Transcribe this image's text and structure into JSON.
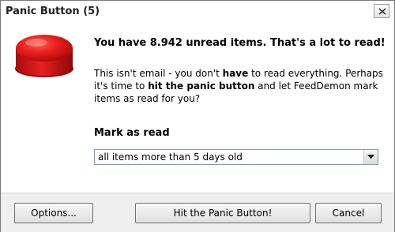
{
  "window": {
    "title": "Panic Button (5)"
  },
  "icons": {
    "panic": "red-panic-button-icon",
    "close": "close-icon",
    "dropdown": "chevron-down-icon"
  },
  "message": {
    "headline": "You have 8.942 unread items. That's a lot to read!",
    "body_part1": "This isn't email - you don't ",
    "body_bold1": "have",
    "body_part2": " to read everything.  Perhaps it's time to ",
    "body_bold2": "hit the panic button",
    "body_part3": " and let FeedDemon mark items as read for you?"
  },
  "mark_as_read": {
    "label": "Mark as read",
    "selected": "all items more than 5 days old"
  },
  "buttons": {
    "options": "Options...",
    "panic": "Hit the Panic Button!",
    "cancel": "Cancel"
  },
  "colors": {
    "panic_red": "#e01818",
    "footer_bg": "#efefef"
  }
}
